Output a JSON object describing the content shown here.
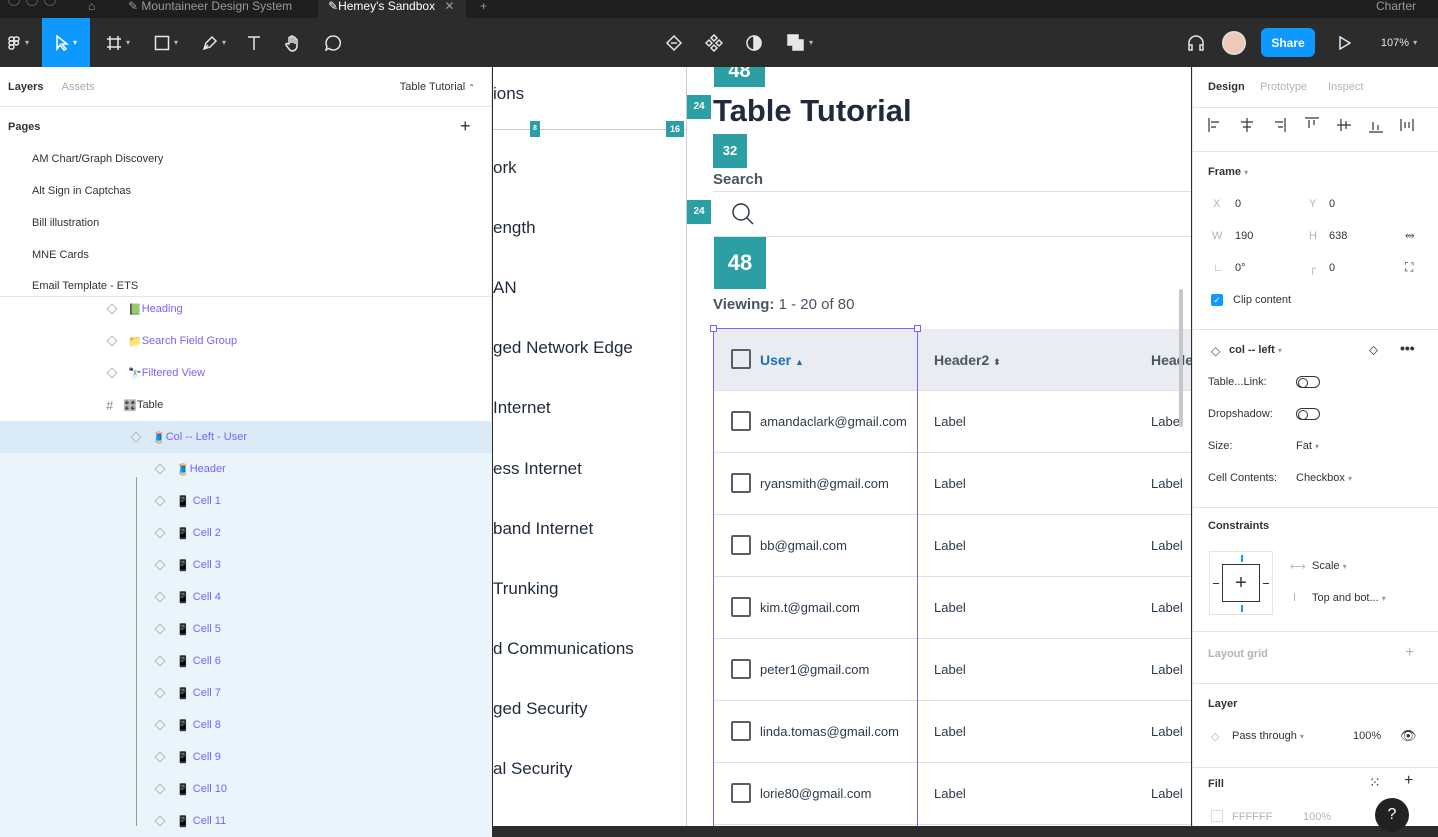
{
  "titlebar": {
    "tabs": [
      "Mountaineer Design System",
      "Hemey's Sandbox"
    ],
    "right": "Charter"
  },
  "toolbar": {
    "share_label": "Share",
    "zoom": "107%"
  },
  "left_panel": {
    "tabs": [
      "Layers",
      "Assets"
    ],
    "page_selector": "Table Tutorial",
    "pages_heading": "Pages",
    "pages": [
      "AM Chart/Graph Discovery",
      "Alt Sign in Captchas",
      "Bill illustration",
      "MNE Cards",
      "Email Template - ETS"
    ],
    "layers": [
      {
        "icon": "📗",
        "label": "Heading"
      },
      {
        "icon": "📁",
        "label": "Search Field Group"
      },
      {
        "icon": "🔭",
        "label": "Filtered View"
      },
      {
        "icon": "🎛️",
        "label": "Table"
      },
      {
        "icon": "🧵",
        "label": "Col -- Left - User"
      },
      {
        "icon": "🧵",
        "label": "Header"
      },
      {
        "icon": "📱",
        "label": "Cell 1"
      },
      {
        "icon": "📱",
        "label": "Cell 2"
      },
      {
        "icon": "📱",
        "label": "Cell 3"
      },
      {
        "icon": "📱",
        "label": "Cell 4"
      },
      {
        "icon": "📱",
        "label": "Cell 5"
      },
      {
        "icon": "📱",
        "label": "Cell 6"
      },
      {
        "icon": "📱",
        "label": "Cell 7"
      },
      {
        "icon": "📱",
        "label": "Cell 8"
      },
      {
        "icon": "📱",
        "label": "Cell 9"
      },
      {
        "icon": "📱",
        "label": "Cell 10"
      },
      {
        "icon": "📱",
        "label": "Cell 11"
      }
    ]
  },
  "canvas": {
    "left_list": [
      "ions",
      "ork",
      "ength",
      "AN",
      "ged Network Edge",
      "Internet",
      "ess Internet",
      "band Internet",
      "Trunking",
      "d Communications",
      "ged Security",
      "al Security"
    ],
    "badges": {
      "top": "48",
      "b24a": "24",
      "b16": "16",
      "b8": "8",
      "b32": "32",
      "b24b": "24",
      "b48": "48"
    },
    "title": "Table Tutorial",
    "search_label": "Search",
    "viewing_label": "Viewing:",
    "viewing_value": "1 - 20 of 80",
    "headers": [
      "User",
      "Header2",
      "Heade"
    ],
    "rows": [
      {
        "email": "amandaclark@gmail.com",
        "c2": "Label",
        "c3": "Label"
      },
      {
        "email": "ryansmith@gmail.com",
        "c2": "Label",
        "c3": "Label"
      },
      {
        "email": "bb@gmail.com",
        "c2": "Label",
        "c3": "Label"
      },
      {
        "email": "kim.t@gmail.com",
        "c2": "Label",
        "c3": "Label"
      },
      {
        "email": "peter1@gmail.com",
        "c2": "Label",
        "c3": "Label"
      },
      {
        "email": "linda.tomas@gmail.com",
        "c2": "Label",
        "c3": "Label"
      },
      {
        "email": "lorie80@gmail.com",
        "c2": "Label",
        "c3": "Label"
      }
    ]
  },
  "right_panel": {
    "tabs": [
      "Design",
      "Prototype",
      "Inspect"
    ],
    "frame_label": "Frame",
    "x_label": "X",
    "x": "0",
    "y_label": "Y",
    "y": "0",
    "w_label": "W",
    "w": "190",
    "h_label": "H",
    "h": "638",
    "rotation": "0°",
    "radius": "0",
    "clip_content": "Clip content",
    "component": "col -- left",
    "prop_table_link": "Table...Link:",
    "prop_dropshadow": "Dropshadow:",
    "prop_size": "Size:",
    "size_value": "Fat",
    "prop_cell_contents": "Cell Contents:",
    "cell_contents_value": "Checkbox",
    "constraints_label": "Constraints",
    "constraint_h": "Scale",
    "constraint_v": "Top and bot...",
    "layout_grid": "Layout grid",
    "layer_label": "Layer",
    "blend": "Pass through",
    "opacity": "100%",
    "fill_label": "Fill",
    "fill_hex": "FFFFFF",
    "fill_opacity": "100%"
  },
  "colors": {
    "accent": "#0d99ff",
    "teal": "#2b9fa3",
    "purple": "#7b61ff"
  }
}
